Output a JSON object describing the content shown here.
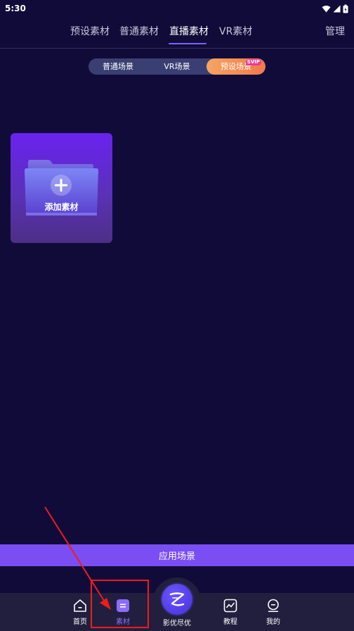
{
  "status_bar": {
    "time": "5:30",
    "icons": [
      "wifi-icon",
      "signal-icon",
      "battery-icon"
    ]
  },
  "top_tabs": {
    "items": [
      {
        "label": "预设素材",
        "active": false
      },
      {
        "label": "普通素材",
        "active": false
      },
      {
        "label": "直播素材",
        "active": true
      },
      {
        "label": "VR素材",
        "active": false
      }
    ],
    "manage_label": "管理"
  },
  "scene_segments": {
    "items": [
      {
        "label": "普通场景",
        "active": false
      },
      {
        "label": "VR场景",
        "active": false
      },
      {
        "label": "预设场景",
        "active": true,
        "badge": "SVIP"
      }
    ]
  },
  "add_card": {
    "label": "添加素材",
    "icon": "folder-plus-icon"
  },
  "apply_button": {
    "label": "应用场景"
  },
  "bottom_nav": {
    "items": [
      {
        "label": "首页",
        "icon": "home-icon",
        "active": false
      },
      {
        "label": "素材",
        "icon": "material-icon",
        "active": true
      },
      {
        "label": "影优尽优",
        "icon": "brand-z-icon",
        "active": false
      },
      {
        "label": "教程",
        "icon": "tutorial-icon",
        "active": false
      },
      {
        "label": "我的",
        "icon": "profile-icon",
        "active": false
      }
    ]
  },
  "colors": {
    "background": "#110b3a",
    "accent": "#7b62ff",
    "apply_bar": "#7a4ef2",
    "segment_active": "#f07a4a",
    "badge": "#ef3a8e",
    "annotation": "#ee1c1c"
  }
}
